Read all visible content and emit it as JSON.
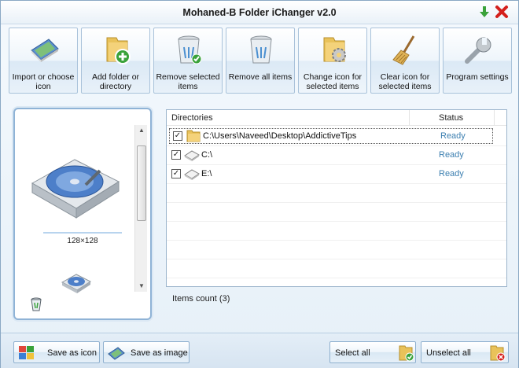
{
  "window": {
    "title": "Mohaned-B Folder iChanger v2.0"
  },
  "titlebar": {
    "minimize_icon": "green-down-arrow-icon",
    "close_icon": "red-x-icon"
  },
  "toolbar": {
    "items": [
      {
        "label": "Import or choose icon",
        "icon": "picture-icon"
      },
      {
        "label": "Add folder or directory",
        "icon": "folder-add-icon"
      },
      {
        "label": "Remove selected items",
        "icon": "recycle-bin-check-icon"
      },
      {
        "label": "Remove all items",
        "icon": "recycle-bin-icon"
      },
      {
        "label": "Change icon for selected items",
        "icon": "folder-gear-icon"
      },
      {
        "label": "Clear icon for selected items",
        "icon": "broom-icon"
      },
      {
        "label": "Program settings",
        "icon": "wrench-icon"
      }
    ]
  },
  "preview": {
    "size_label": "128×128",
    "icon": "hard-drive-icon"
  },
  "list": {
    "headers": {
      "directories": "Directories",
      "status": "Status"
    },
    "rows": [
      {
        "path": "C:\\Users\\Naveed\\Desktop\\AddictiveTips",
        "status": "Ready",
        "checked": true,
        "icon": "folder-icon"
      },
      {
        "path": "C:\\",
        "status": "Ready",
        "checked": true,
        "icon": "drive-icon"
      },
      {
        "path": "E:\\",
        "status": "Ready",
        "checked": true,
        "icon": "drive-icon"
      }
    ],
    "check_glyph": "✓"
  },
  "items_count": "Items count (3)",
  "bottom": {
    "save_as_icon": "Save as icon",
    "save_as_image": "Save as image",
    "select_all": "Select all",
    "unselect_all": "Unselect all"
  },
  "colors": {
    "status_ready": "#3c7fb0",
    "accent_border": "#8fb3d6"
  }
}
